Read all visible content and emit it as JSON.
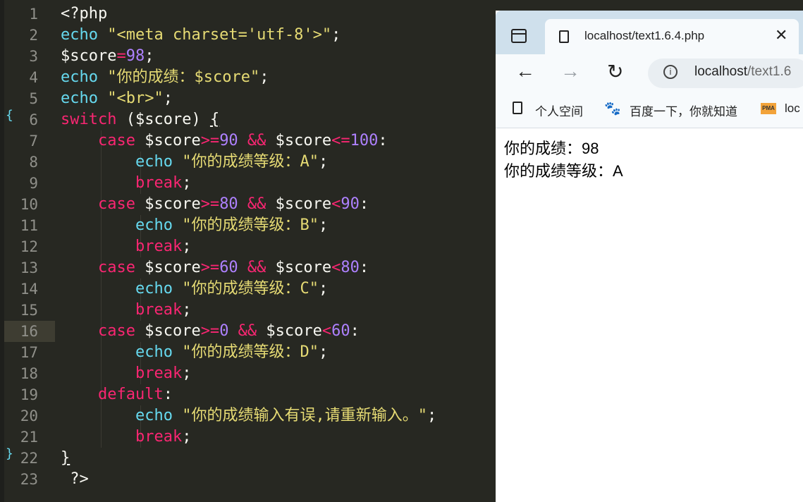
{
  "editor": {
    "lines": [
      {
        "n": "1"
      },
      {
        "n": "2"
      },
      {
        "n": "3"
      },
      {
        "n": "4"
      },
      {
        "n": "5"
      },
      {
        "n": "6"
      },
      {
        "n": "7"
      },
      {
        "n": "8"
      },
      {
        "n": "9"
      },
      {
        "n": "10"
      },
      {
        "n": "11"
      },
      {
        "n": "12"
      },
      {
        "n": "13"
      },
      {
        "n": "14"
      },
      {
        "n": "15"
      },
      {
        "n": "16"
      },
      {
        "n": "17"
      },
      {
        "n": "18"
      },
      {
        "n": "19"
      },
      {
        "n": "20"
      },
      {
        "n": "21"
      },
      {
        "n": "22"
      },
      {
        "n": "23"
      }
    ],
    "code": {
      "l1": "<?php",
      "l2_kw": "echo",
      "l2_str": "\"<meta charset='utf-8'>\"",
      "l2_end": ";",
      "l3_var": "$score",
      "l3_op": "=",
      "l3_num": "98",
      "l3_end": ";",
      "l4_kw": "echo",
      "l4_str": "\"你的成绩：$score\"",
      "l4_end": ";",
      "l5_kw": "echo",
      "l5_str": "\"<br>\"",
      "l5_end": ";",
      "l6_kw": "switch",
      "l6_rest": " ($score) ",
      "l6_brace": "{",
      "case_kw": "case",
      "c1_a": " $score",
      "c1_op1": ">=",
      "c1_n1": "90",
      "c1_and": " && ",
      "c1_b": "$score",
      "c1_op2": "<=",
      "c1_n2": "100",
      "c1_end": ":",
      "echo_kw": "echo",
      "c1_str": "\"你的成绩等级：A\"",
      "semi": ";",
      "break_kw": "break",
      "c2_a": " $score",
      "c2_op1": ">=",
      "c2_n1": "80",
      "c2_and": " && ",
      "c2_b": "$score",
      "c2_op2": "<",
      "c2_n2": "90",
      "c2_end": ":",
      "c2_str": "\"你的成绩等级：B\"",
      "c3_a": " $score",
      "c3_op1": ">=",
      "c3_n1": "60",
      "c3_and": " && ",
      "c3_b": "$score",
      "c3_op2": "<",
      "c3_n2": "80",
      "c3_end": ":",
      "c3_str": "\"你的成绩等级：C\"",
      "c4_a": " $score",
      "c4_op1": ">=",
      "c4_n1": "0",
      "c4_and": " && ",
      "c4_b": "$score",
      "c4_op2": "<",
      "c4_n2": "60",
      "c4_end": ":",
      "c4_str": "\"你的成绩等级：D\"",
      "default_kw": "default",
      "default_end": ":",
      "d_str": "\"你的成绩输入有误,请重新输入。\"",
      "close_brace": "}",
      "php_close": "?>"
    },
    "fold_open": "{",
    "fold_close": "}"
  },
  "browser": {
    "tab_title": "localhost/text1.6.4.php",
    "tab_close": "✕",
    "back": "←",
    "forward": "→",
    "reload": "↻",
    "info": "i",
    "url_host": "localhost",
    "url_rest": "/text1.6",
    "bookmarks": [
      {
        "label": "个人空间"
      },
      {
        "label": "百度一下，你就知道"
      },
      {
        "label": "loc"
      }
    ],
    "bookmark_pma": "PMA",
    "baidu_icon": "🐾",
    "content_line1": "你的成绩：98",
    "content_line2": "你的成绩等级：A"
  }
}
